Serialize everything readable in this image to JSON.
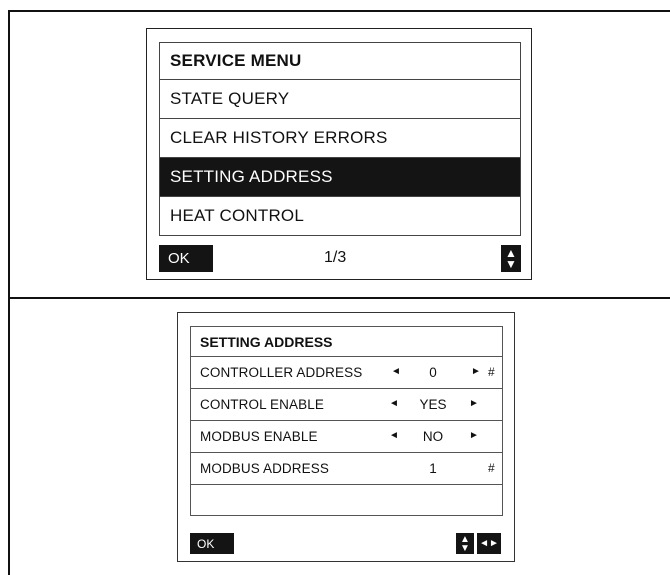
{
  "service_menu": {
    "title": "SERVICE MENU",
    "items": [
      {
        "label": "STATE QUERY",
        "selected": false
      },
      {
        "label": "CLEAR HISTORY ERRORS",
        "selected": false
      },
      {
        "label": "SETTING ADDRESS",
        "selected": true
      },
      {
        "label": "HEAT CONTROL",
        "selected": false
      }
    ],
    "ok_label": "OK",
    "page": "1/3",
    "updown_icon": "up-down-arrows-icon"
  },
  "setting_address": {
    "title": "SETTING ADDRESS",
    "rows": [
      {
        "label": "CONTROLLER ADDRESS",
        "value": "0",
        "left_arrow": "◄",
        "right_arrow": "►",
        "hash": "#"
      },
      {
        "label": "CONTROL ENABLE",
        "value": "YES",
        "left_arrow": "◄",
        "right_arrow": "►"
      },
      {
        "label": "MODBUS ENABLE",
        "value": "NO",
        "left_arrow": "◄",
        "right_arrow": "►"
      },
      {
        "label": "MODBUS ADDRESS",
        "value": "1",
        "hash": "#"
      }
    ],
    "ok_label": "OK",
    "updown_icon": "up-down-arrows-icon",
    "leftright_icon": "left-right-arrows-icon"
  },
  "colors": {
    "selected_bg": "#141414",
    "selected_fg": "#ffffff",
    "border": "#222222"
  }
}
